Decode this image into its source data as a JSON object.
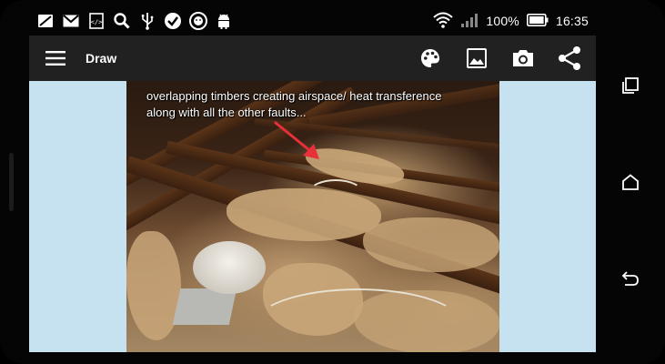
{
  "status_bar": {
    "icons_left": [
      "no-sim-icon",
      "gmail-icon",
      "code-icon",
      "search-icon",
      "usb-icon",
      "check-circle-icon",
      "lion-icon",
      "android-icon"
    ],
    "battery_text": "100%",
    "time": "16:35"
  },
  "app_bar": {
    "title": "Draw",
    "actions": [
      "palette-icon",
      "image-icon",
      "camera-icon",
      "share-icon"
    ]
  },
  "image": {
    "caption": "overlapping  timbers creating airspace/ heat transference\nalong with all the other faults..."
  },
  "colors": {
    "app_bar": "#212121",
    "canvas_background": "#c6e2f1",
    "arrow": "#e8303a"
  },
  "nav_bar": {
    "buttons": [
      "recents-icon",
      "home-icon",
      "back-icon"
    ]
  }
}
